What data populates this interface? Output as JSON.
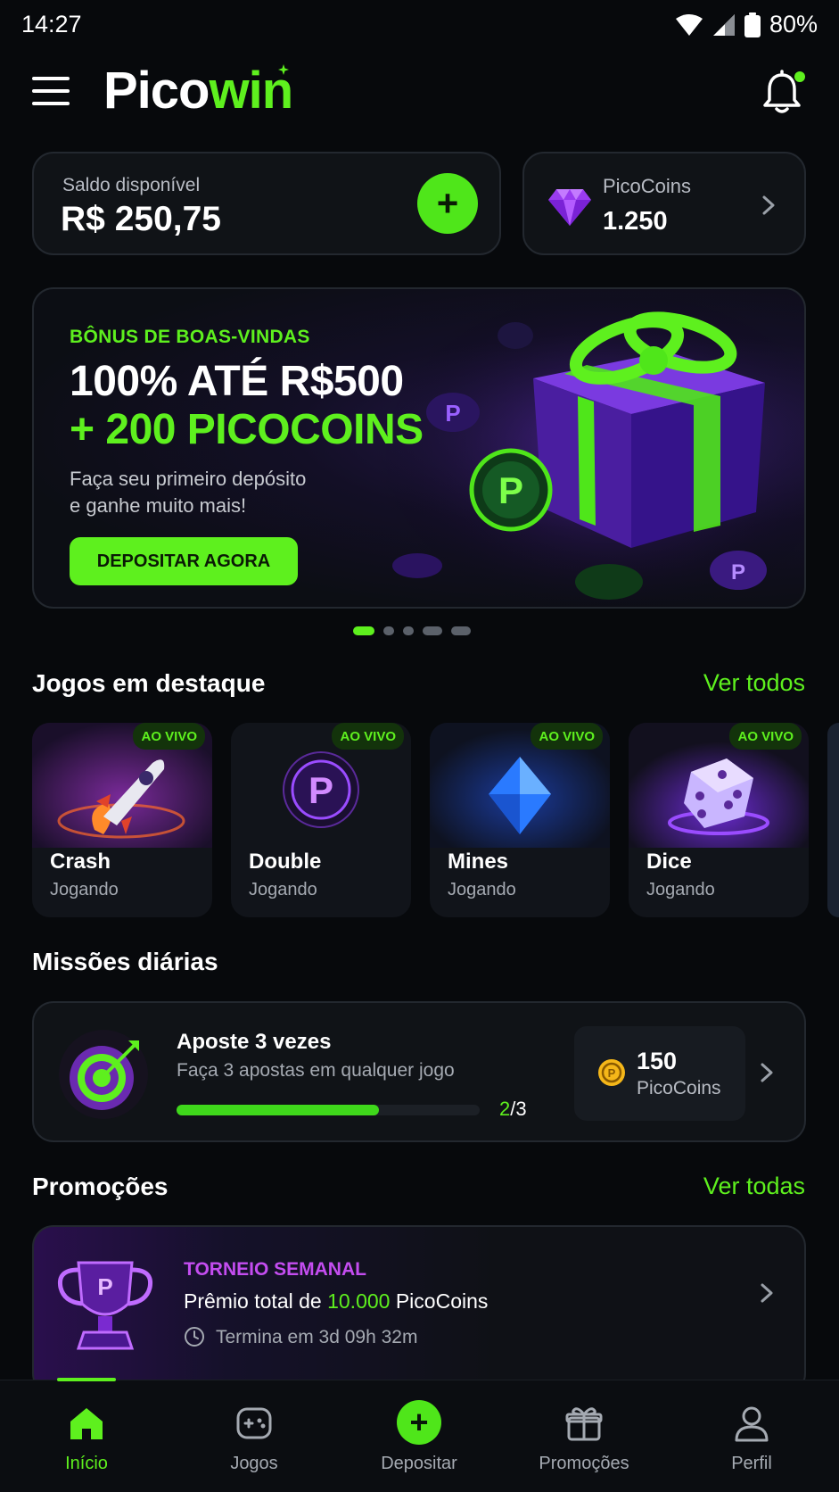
{
  "status_bar": {
    "time": "14:27",
    "battery": "80%"
  },
  "header": {
    "logo_prefix": "Pico",
    "logo_suffix": "win"
  },
  "balance": {
    "label": "Saldo disponível",
    "value": "R$ 250,75",
    "add_symbol": "+"
  },
  "coins": {
    "label": "PicoCoins",
    "value": "1.250"
  },
  "banner": {
    "eyebrow": "BÔNUS DE BOAS-VINDAS",
    "title_line1": "100% ATÉ R$500",
    "title_line2": "+ 200 PICOCOINS",
    "subtitle_line1": "Faça seu primeiro depósito",
    "subtitle_line2": "e ganhe muito mais!",
    "cta": "DEPOSITAR AGORA",
    "slide_count": 5,
    "active_slide": 1
  },
  "featured": {
    "title": "Jogos em destaque",
    "link": "Ver todos",
    "games": [
      {
        "name": "Crash",
        "status": "Jogando",
        "badge": "AO VIVO",
        "icon": "rocket-icon"
      },
      {
        "name": "Double",
        "status": "Jogando",
        "badge": "AO VIVO",
        "icon": "p-coin-icon"
      },
      {
        "name": "Mines",
        "status": "Jogando",
        "badge": "AO VIVO",
        "icon": "diamond-icon"
      },
      {
        "name": "Dice",
        "status": "Jogando",
        "badge": "AO VIVO",
        "icon": "dice-icon"
      }
    ]
  },
  "missions": {
    "title": "Missões diárias",
    "item": {
      "title": "Aposte 3 vezes",
      "description": "Faça 3 apostas em qualquer jogo",
      "progress_current": "2",
      "progress_total": "/3",
      "progress_fraction": 0.667,
      "reward_value": "150",
      "reward_label": "PicoCoins"
    }
  },
  "promotions": {
    "title": "Promoções",
    "link": "Ver todas",
    "item": {
      "eyebrow": "TORNEIO SEMANAL",
      "title_prefix": "Prêmio total de ",
      "title_highlight": "10.000",
      "title_suffix": " PicoCoins",
      "time": "Termina em 3d 09h 32m"
    }
  },
  "bottom_nav": [
    {
      "label": "Início",
      "icon": "home-icon",
      "active": true
    },
    {
      "label": "Jogos",
      "icon": "gamepad-icon",
      "active": false
    },
    {
      "label": "Depositar",
      "icon": "plus-circle-icon",
      "active": false
    },
    {
      "label": "Promoções",
      "icon": "gift-icon",
      "active": false
    },
    {
      "label": "Perfil",
      "icon": "user-icon",
      "active": false
    }
  ],
  "colors": {
    "accent": "#5ef01e",
    "background": "#07090c",
    "card": "#101317",
    "promo_accent": "#c44df0"
  }
}
